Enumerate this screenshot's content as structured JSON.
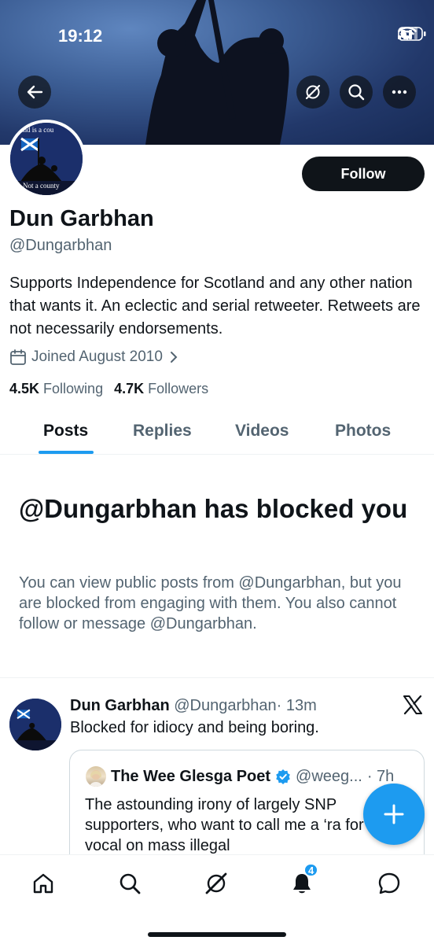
{
  "status_bar": {
    "time": "19:12"
  },
  "profile": {
    "display_name": "Dun Garbhan",
    "handle": "@Dungarbhan",
    "bio": "Supports Independence for Scotland and any other nation that wants it. An eclectic and serial retweeter. Retweets are not necessarily endorsements.",
    "joined": "Joined August 2010",
    "following_count": "4.5K",
    "following_label": "Following",
    "followers_count": "4.7K",
    "followers_label": "Followers",
    "follow_button": "Follow",
    "avatar_text_top": "land is a cou",
    "avatar_text_bottom": "Not a county"
  },
  "tabs": [
    {
      "label": "Posts",
      "active": true
    },
    {
      "label": "Replies"
    },
    {
      "label": "Videos"
    },
    {
      "label": "Photos"
    }
  ],
  "blocked": {
    "title": "@Dungarbhan has blocked you",
    "description": "You can view public posts from @Dungarbhan, but you are blocked from engaging with them. You also cannot follow or message @Dungarbhan."
  },
  "post": {
    "author_name": "Dun Garbhan",
    "author_handle": "@Dungarbhan",
    "time": "· 13m",
    "text": "Blocked for idiocy and being boring.",
    "quote": {
      "author_name": "The Wee Glesga Poet",
      "author_handle": "@weeg...",
      "time": "· 7h",
      "text": "The astounding irony of largely SNP supporters, who want to call me a ‘ra for being vocal on mass illegal"
    }
  },
  "bottom_nav": {
    "notifications_badge": "4"
  },
  "icons": [
    "back-arrow-icon",
    "grok-icon",
    "search-icon",
    "more-icon",
    "calendar-icon",
    "chevron-right-icon",
    "x-logo-icon",
    "verified-badge-icon",
    "compose-plus-icon",
    "home-icon",
    "bell-icon",
    "messages-icon"
  ],
  "colors": {
    "accent": "#1d9bf0",
    "text": "#0f1419",
    "muted": "#536471",
    "follow_button": "#0f1419"
  }
}
